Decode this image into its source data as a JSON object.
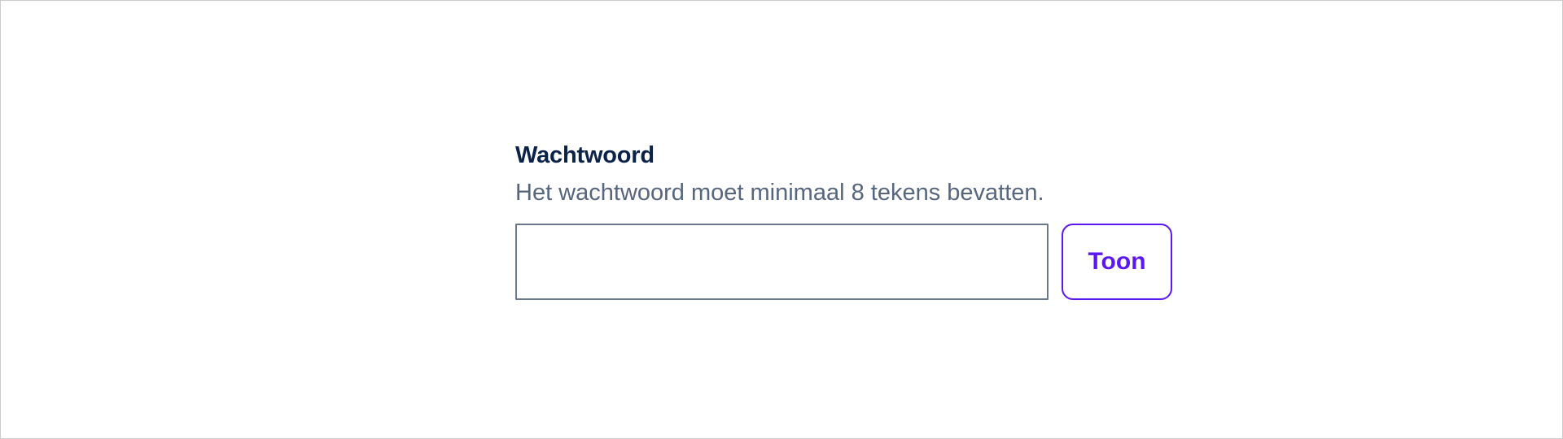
{
  "password_field": {
    "label": "Wachtwoord",
    "hint": "Het wachtwoord moet minimaal 8 tekens bevatten.",
    "input_value": "",
    "toggle_label": "Toon"
  },
  "colors": {
    "label": "#0b2249",
    "hint": "#56667f",
    "input_border": "#69778f",
    "button_accent": "#5b18f2",
    "frame_border": "#cccccc"
  }
}
